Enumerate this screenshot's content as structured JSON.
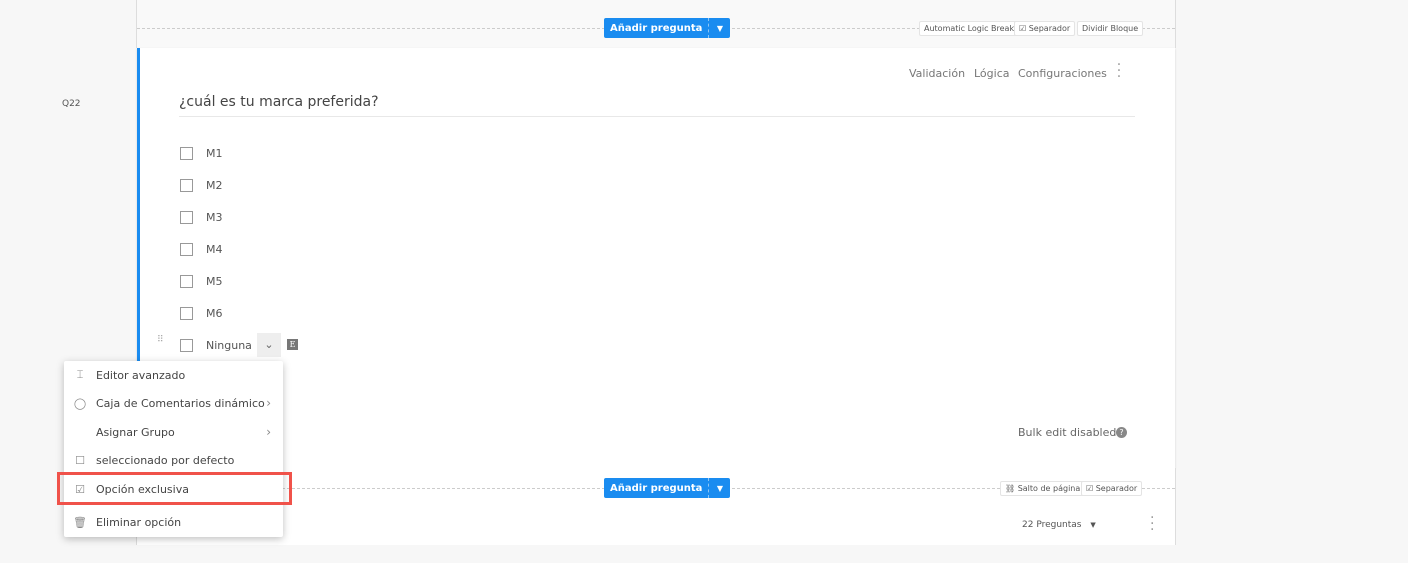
{
  "top_bar": {
    "add_question": "Añadir pregunta",
    "chips": [
      "Automatic Logic Break",
      "Separador",
      "Dividir Bloque"
    ]
  },
  "question": {
    "number": "Q22",
    "title": "¿cuál es tu marca preferida?",
    "toolbar": [
      "Validación",
      "Lógica",
      "Configuraciones"
    ],
    "options": [
      "M1",
      "M2",
      "M3",
      "M4",
      "M5",
      "M6",
      "Ninguna"
    ],
    "exclusive_badge": "E",
    "bulk_edit": "Bulk edit disabled"
  },
  "context_menu": {
    "items": [
      {
        "icon": "text-cursor-icon",
        "label": "Editor avanzado"
      },
      {
        "icon": "comment-icon",
        "label": "Caja de Comentarios dinámico",
        "submenu": true
      },
      {
        "icon": "",
        "label": "Asignar Grupo",
        "submenu": true
      },
      {
        "icon": "checkbox-icon",
        "label": "seleccionado por defecto"
      },
      {
        "icon": "checked-box-icon",
        "label": "Opción exclusiva",
        "highlighted": true
      },
      {
        "icon": "trash-icon",
        "label": "Eliminar opción"
      }
    ]
  },
  "bottom_bar": {
    "add_question": "Añadir pregunta",
    "chips": [
      "Salto de página",
      "Separador"
    ],
    "count": "22 Preguntas"
  },
  "colors": {
    "accent": "#1a8cf0",
    "highlight": "#f0524a"
  }
}
